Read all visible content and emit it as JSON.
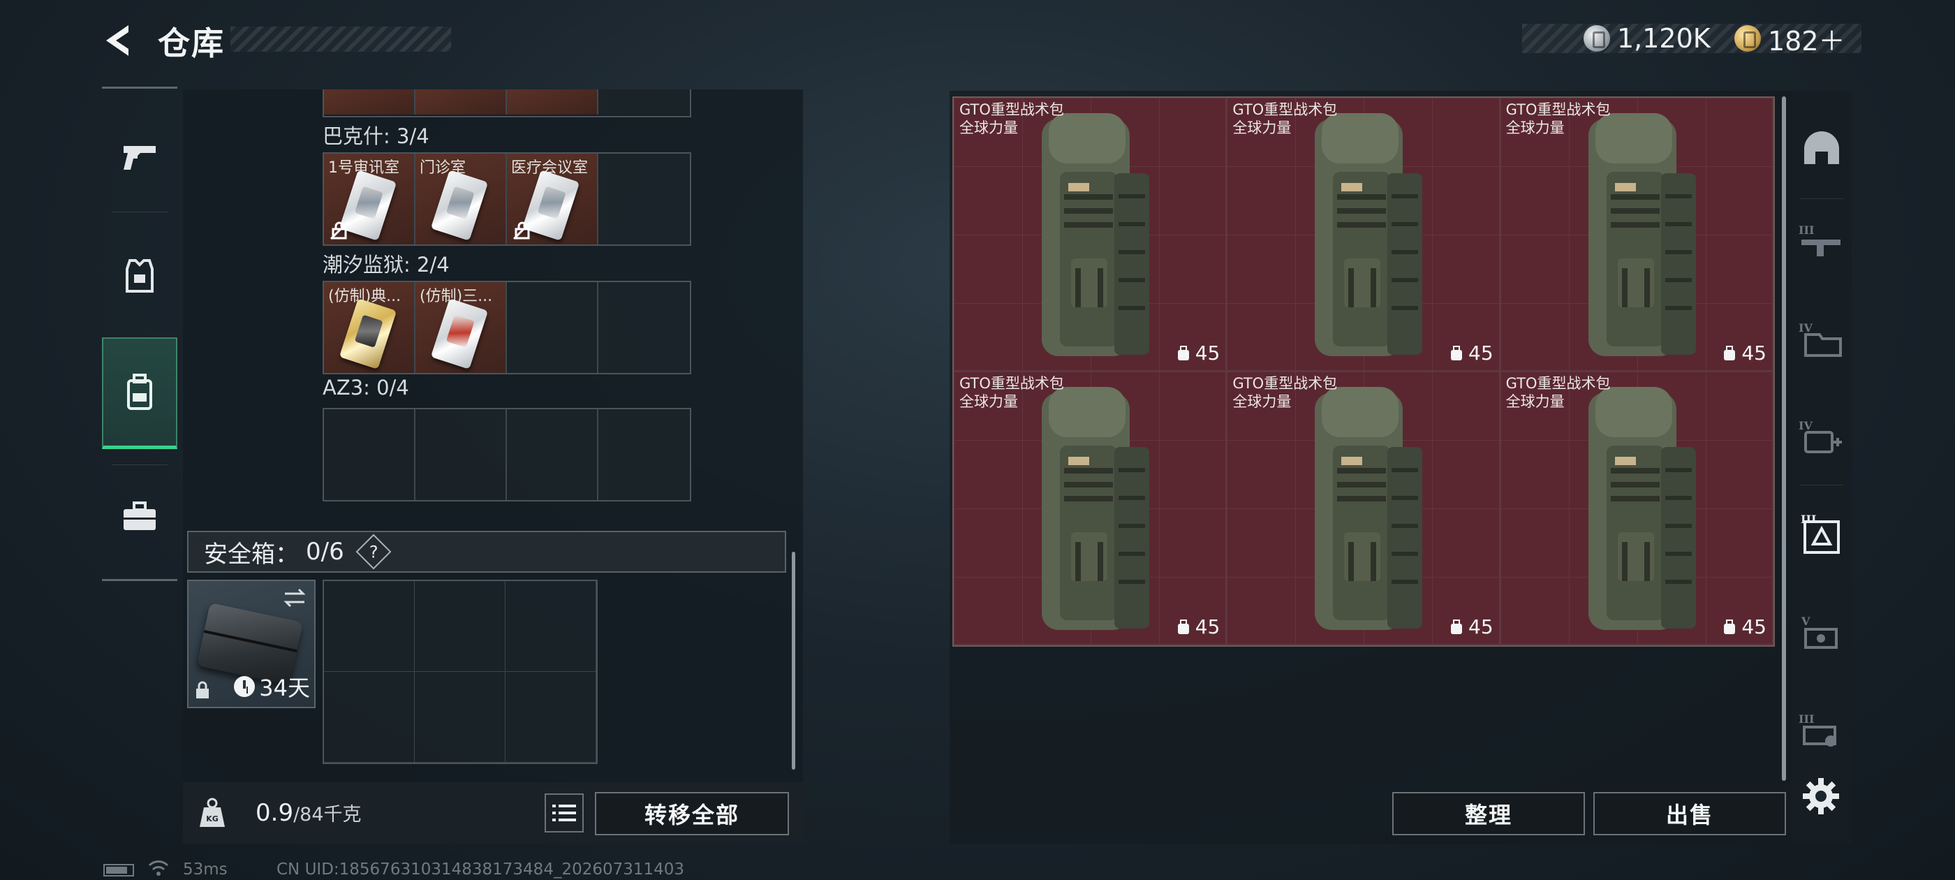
{
  "header": {
    "title": "仓库",
    "currencies": [
      {
        "icon": "silver-coin-icon",
        "value": "1,120K"
      },
      {
        "icon": "gold-coin-icon",
        "value": "182＋"
      }
    ]
  },
  "left_rail": {
    "items": [
      {
        "name": "weapons",
        "icon": "pistol-icon",
        "active": false
      },
      {
        "name": "equipment",
        "icon": "armor-icon",
        "active": false
      },
      {
        "name": "backpack",
        "icon": "backpack-icon",
        "active": true
      },
      {
        "name": "items",
        "icon": "briefcase-icon",
        "active": false
      }
    ]
  },
  "key_sections": [
    {
      "label": "巴克什: 3/4",
      "slots": [
        {
          "name": "1号审讯室",
          "type": "white",
          "no_lock": true
        },
        {
          "name": "门诊室",
          "type": "white",
          "no_lock": false
        },
        {
          "name": "医疗会议室",
          "type": "white",
          "no_lock": true
        },
        null
      ]
    },
    {
      "label": "潮汐监狱: 2/4",
      "slots": [
        {
          "name": "(仿制)典...",
          "type": "gold",
          "no_lock": false
        },
        {
          "name": "(仿制)三...",
          "type": "red",
          "no_lock": false
        },
        null,
        null
      ]
    },
    {
      "label": "AZ3: 0/4",
      "slots": [
        null,
        null,
        null,
        null
      ]
    }
  ],
  "safebox": {
    "label": "安全箱：",
    "count": "0/6",
    "help": "?",
    "case_days": "34天"
  },
  "weight": {
    "current": "0.9",
    "max": "/84千克"
  },
  "buttons": {
    "transfer_all": "转移全部",
    "sort": "整理",
    "sell": "出售"
  },
  "stash": {
    "items": [
      {
        "name": "GTO重型战术包",
        "source": "全球力量",
        "count": "45"
      },
      {
        "name": "GTO重型战术包",
        "source": "全球力量",
        "count": "45"
      },
      {
        "name": "GTO重型战术包",
        "source": "全球力量",
        "count": "45"
      },
      {
        "name": "GTO重型战术包",
        "source": "全球力量",
        "count": "45"
      },
      {
        "name": "GTO重型战术包",
        "source": "全球力量",
        "count": "45"
      },
      {
        "name": "GTO重型战术包",
        "source": "全球力量",
        "count": "45"
      }
    ]
  },
  "right_rail": {
    "items": [
      {
        "name": "helmet",
        "icon": "helmet-icon"
      },
      {
        "name": "tier-III-weapons",
        "icon": "tier-3-rifle-icon"
      },
      {
        "name": "tier-IV-folder",
        "icon": "tier-4-folder-icon"
      },
      {
        "name": "tier-IV-medical",
        "icon": "tier-4-medkit-icon"
      },
      {
        "name": "safebox",
        "icon": "safebox-icon"
      },
      {
        "name": "tier-V-ammo",
        "icon": "tier-5-ammo-icon"
      },
      {
        "name": "tier-III-tools",
        "icon": "tier-3-tools-icon"
      }
    ]
  },
  "status": {
    "ping": "53ms",
    "uid": "CN UID:18567631031483817348​4_202607311403"
  },
  "colors": {
    "accent": "#37d38d",
    "item_bg": "#5a2730",
    "key_bg": "#5a3227"
  }
}
